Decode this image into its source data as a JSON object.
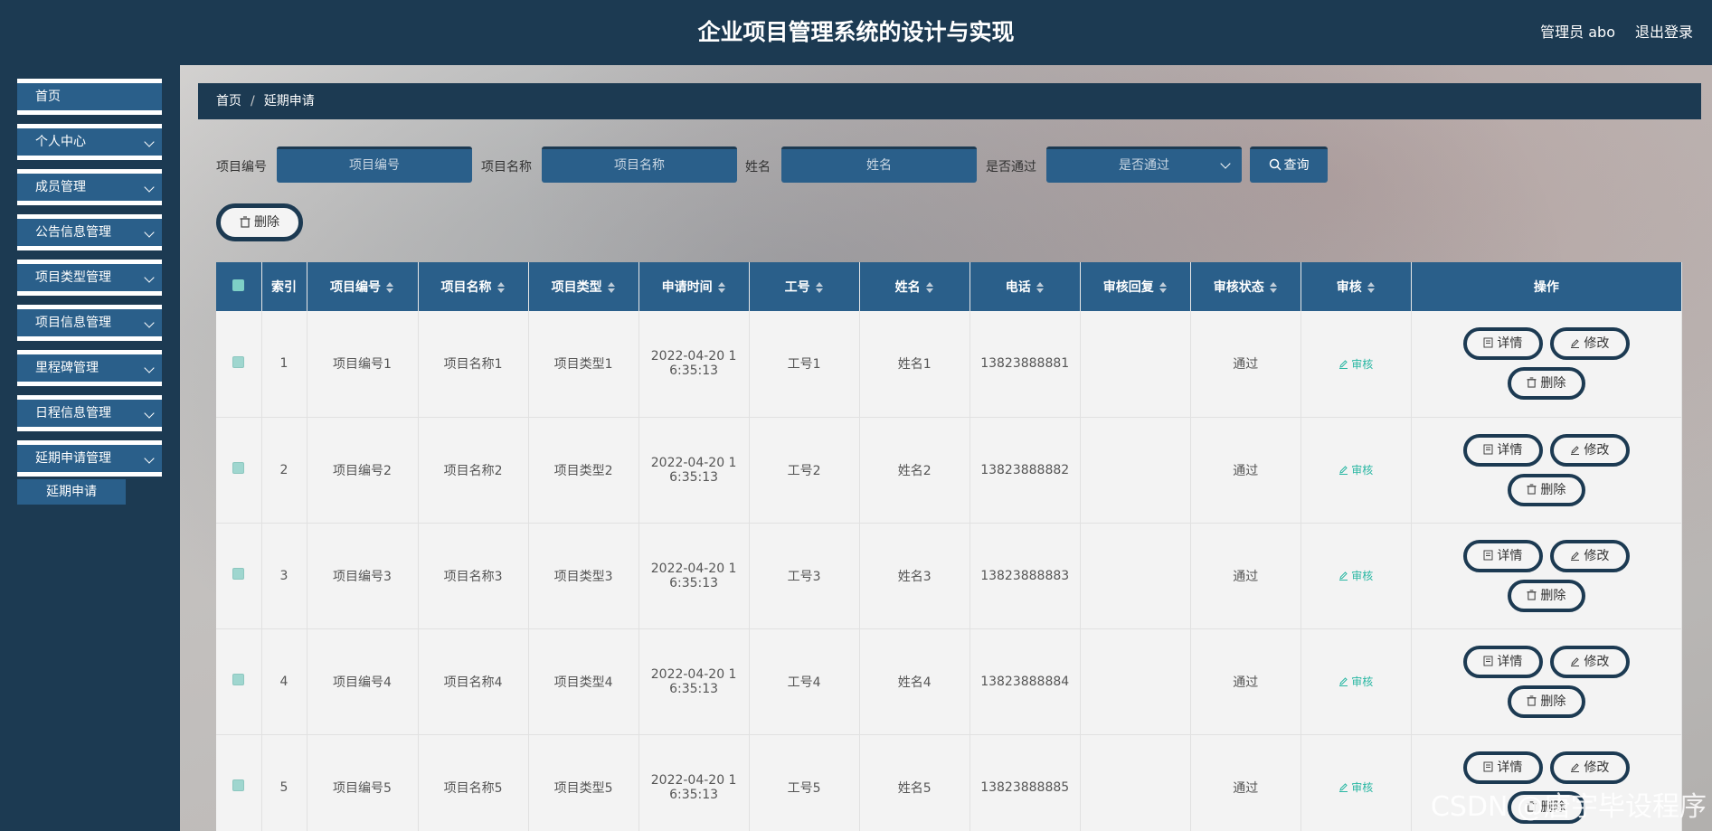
{
  "header": {
    "title": "企业项目管理系统的设计与实现",
    "user": "管理员 abo",
    "logout": "退出登录"
  },
  "sidebar": {
    "items": [
      {
        "label": "首页"
      },
      {
        "label": "个人中心"
      },
      {
        "label": "成员管理"
      },
      {
        "label": "公告信息管理"
      },
      {
        "label": "项目类型管理"
      },
      {
        "label": "项目信息管理"
      },
      {
        "label": "里程碑管理"
      },
      {
        "label": "日程信息管理"
      },
      {
        "label": "延期申请管理"
      }
    ],
    "sub_item": "延期申请"
  },
  "breadcrumb": {
    "home": "首页",
    "sep": "/",
    "current": "延期申请"
  },
  "search": {
    "project_no_label": "项目编号",
    "project_no_placeholder": "项目编号",
    "project_name_label": "项目名称",
    "project_name_placeholder": "项目名称",
    "name_label": "姓名",
    "name_placeholder": "姓名",
    "passed_label": "是否通过",
    "passed_placeholder": "是否通过",
    "query_button": "查询"
  },
  "toolbar": {
    "delete_button": "删除"
  },
  "table": {
    "headers": [
      "索引",
      "项目编号",
      "项目名称",
      "项目类型",
      "申请时间",
      "工号",
      "姓名",
      "电话",
      "审核回复",
      "审核状态",
      "审核",
      "操作"
    ],
    "audit_link": "审核",
    "detail_btn": "详情",
    "edit_btn": "修改",
    "delete_btn": "删除",
    "rows": [
      {
        "index": "1",
        "project_no": "项目编号1",
        "project_name": "项目名称1",
        "project_type": "项目类型1",
        "time_a": "2022-04-20 1",
        "time_b": "6:35:13",
        "emp_no": "工号1",
        "name": "姓名1",
        "phone": "13823888881",
        "reply": "",
        "status": "通过"
      },
      {
        "index": "2",
        "project_no": "项目编号2",
        "project_name": "项目名称2",
        "project_type": "项目类型2",
        "time_a": "2022-04-20 1",
        "time_b": "6:35:13",
        "emp_no": "工号2",
        "name": "姓名2",
        "phone": "13823888882",
        "reply": "",
        "status": "通过"
      },
      {
        "index": "3",
        "project_no": "项目编号3",
        "project_name": "项目名称3",
        "project_type": "项目类型3",
        "time_a": "2022-04-20 1",
        "time_b": "6:35:13",
        "emp_no": "工号3",
        "name": "姓名3",
        "phone": "13823888883",
        "reply": "",
        "status": "通过"
      },
      {
        "index": "4",
        "project_no": "项目编号4",
        "project_name": "项目名称4",
        "project_type": "项目类型4",
        "time_a": "2022-04-20 1",
        "time_b": "6:35:13",
        "emp_no": "工号4",
        "name": "姓名4",
        "phone": "13823888884",
        "reply": "",
        "status": "通过"
      },
      {
        "index": "5",
        "project_no": "项目编号5",
        "project_name": "项目名称5",
        "project_type": "项目类型5",
        "time_a": "2022-04-20 1",
        "time_b": "6:35:13",
        "emp_no": "工号5",
        "name": "姓名5",
        "phone": "13823888885",
        "reply": "",
        "status": "通过"
      }
    ]
  },
  "watermark": "CSDN @唐宇毕设程序",
  "colors": {
    "header_bg": "#1c3a52",
    "accent": "#2a5f8a",
    "audit_link": "#2ab7a3"
  }
}
